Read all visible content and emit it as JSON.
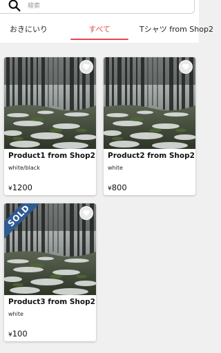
{
  "search": {
    "placeholder": "検索",
    "value": ""
  },
  "tabs": [
    {
      "label": "おきにいり",
      "active": false
    },
    {
      "label": "すべて",
      "active": true
    },
    {
      "label": "Tシャツ from Shop2",
      "active": false
    }
  ],
  "colors": {
    "accent": "#e5474d",
    "sold_badge": "#2f5b8f"
  },
  "products": [
    {
      "name": "Product1 from Shop2",
      "variant": "white/black",
      "currency": "¥",
      "price": "1200",
      "sold": false,
      "fav_icon": "heart-icon"
    },
    {
      "name": "Product2 from Shop2",
      "variant": "white",
      "currency": "¥",
      "price": "800",
      "sold": false,
      "fav_icon": "heart-icon"
    },
    {
      "name": "Product3 from Shop2",
      "variant": "white",
      "currency": "¥",
      "price": "100",
      "sold": true,
      "sold_label": "SOLD",
      "fav_icon": "heart-icon"
    }
  ]
}
